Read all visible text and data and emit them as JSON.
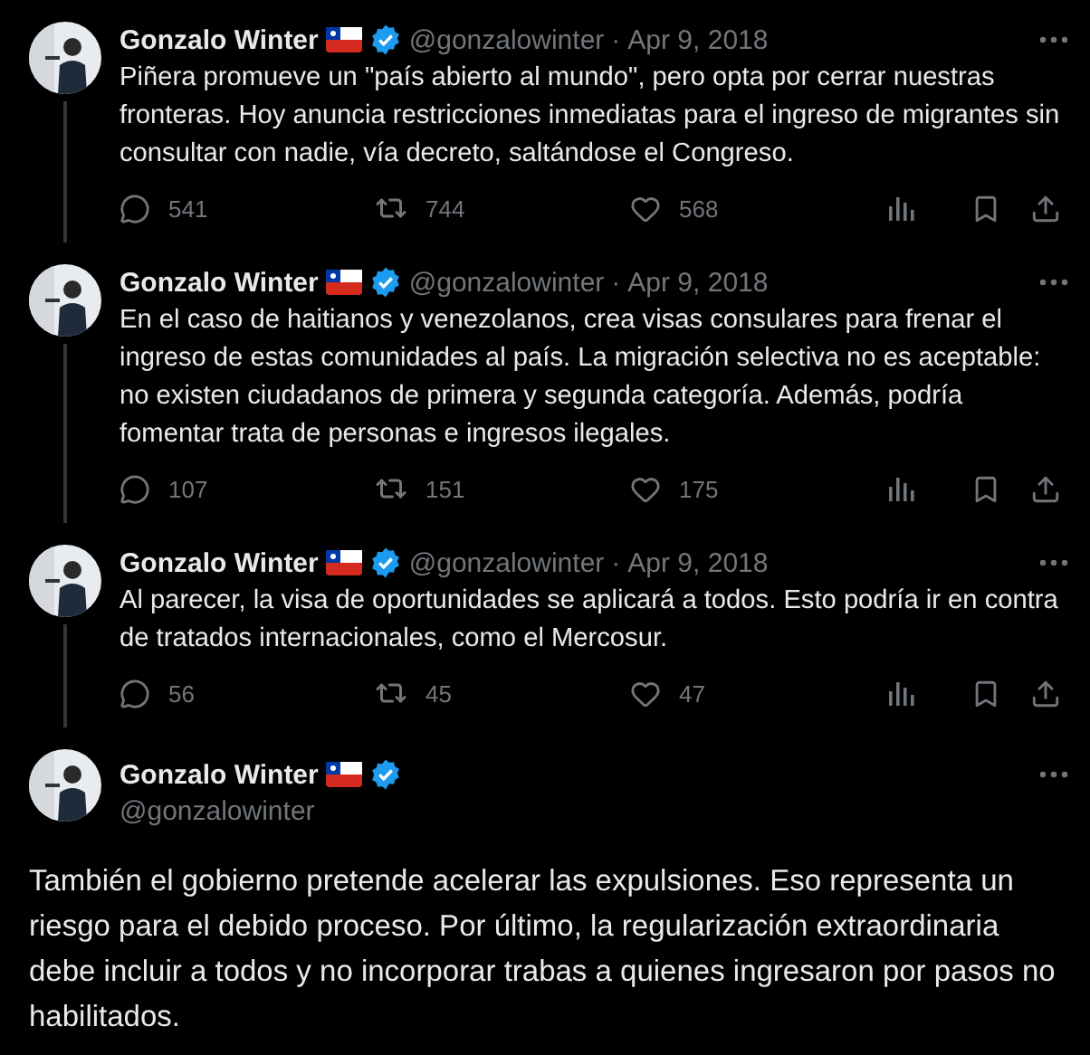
{
  "thread": [
    {
      "name": "Gonzalo Winter",
      "handle": "@gonzalowinter",
      "separator": "·",
      "date": "Apr 9, 2018",
      "text": "Piñera promueve un \"país abierto al mundo\", pero opta por cerrar nuestras fronteras. Hoy anuncia restricciones inmediatas para el ingreso de migrantes sin consultar con nadie, vía decreto, saltándose el Congreso.",
      "replies": "541",
      "reposts": "744",
      "likes": "568"
    },
    {
      "name": "Gonzalo Winter",
      "handle": "@gonzalowinter",
      "separator": "·",
      "date": "Apr 9, 2018",
      "text": "En el caso de haitianos y venezolanos, crea visas consulares para frenar el ingreso de estas comunidades al país. La migración selectiva no es aceptable: no existen ciudadanos de primera y segunda categoría. Además, podría fomentar trata de personas e ingresos ilegales.",
      "replies": "107",
      "reposts": "151",
      "likes": "175"
    },
    {
      "name": "Gonzalo Winter",
      "handle": "@gonzalowinter",
      "separator": "·",
      "date": "Apr 9, 2018",
      "text": "Al parecer, la visa de oportunidades se aplicará a todos. Esto podría ir en contra de tratados internacionales, como el Mercosur.",
      "replies": "56",
      "reposts": "45",
      "likes": "47"
    }
  ],
  "main_post": {
    "name": "Gonzalo Winter",
    "handle": "@gonzalowinter",
    "text": "También el gobierno pretende acelerar las expulsiones. Eso representa un riesgo para  el debido proceso. Por último, la regularización extraordinaria debe incluir a todos y no incorporar trabas a quienes ingresaron por pasos no habilitados."
  }
}
